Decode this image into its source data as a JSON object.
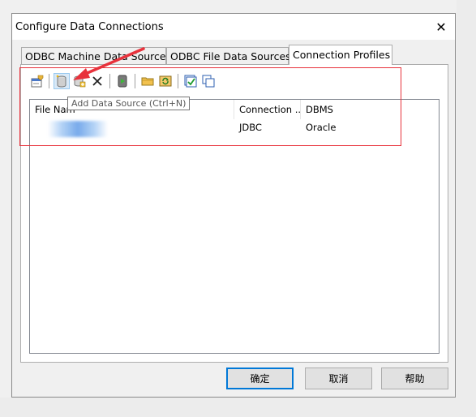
{
  "dialog": {
    "title": "Configure Data Connections",
    "close_glyph": "✕"
  },
  "tabs": [
    {
      "label": "ODBC Machine Data Sources",
      "active": false
    },
    {
      "label": "ODBC File Data Sources",
      "active": false
    },
    {
      "label": "Connection Profiles",
      "active": true
    }
  ],
  "toolbar": {
    "buttons": [
      {
        "icon": "properties-icon",
        "tooltip": ""
      },
      {
        "icon": "add-data-source-icon",
        "tooltip": "Add Data Source (Ctrl+N)"
      },
      {
        "icon": "add-profile-icon",
        "tooltip": ""
      },
      {
        "icon": "delete-icon",
        "tooltip": ""
      },
      {
        "icon": "database-run-icon",
        "tooltip": ""
      },
      {
        "icon": "open-folder-icon",
        "tooltip": ""
      },
      {
        "icon": "refresh-icon",
        "tooltip": ""
      },
      {
        "icon": "check-icon",
        "tooltip": ""
      },
      {
        "icon": "copy-icon",
        "tooltip": ""
      }
    ]
  },
  "tooltip": {
    "text": "Add Data Source (Ctrl+N)"
  },
  "table": {
    "columns": [
      "File Nam",
      "Connection ...",
      "DBMS"
    ],
    "rows": [
      {
        "file_name": "",
        "connection": "JDBC",
        "dbms": "Oracle"
      }
    ]
  },
  "buttons": {
    "ok": "确定",
    "cancel": "取消",
    "help": "帮助"
  },
  "annotation": {
    "color": "#e8323c"
  }
}
